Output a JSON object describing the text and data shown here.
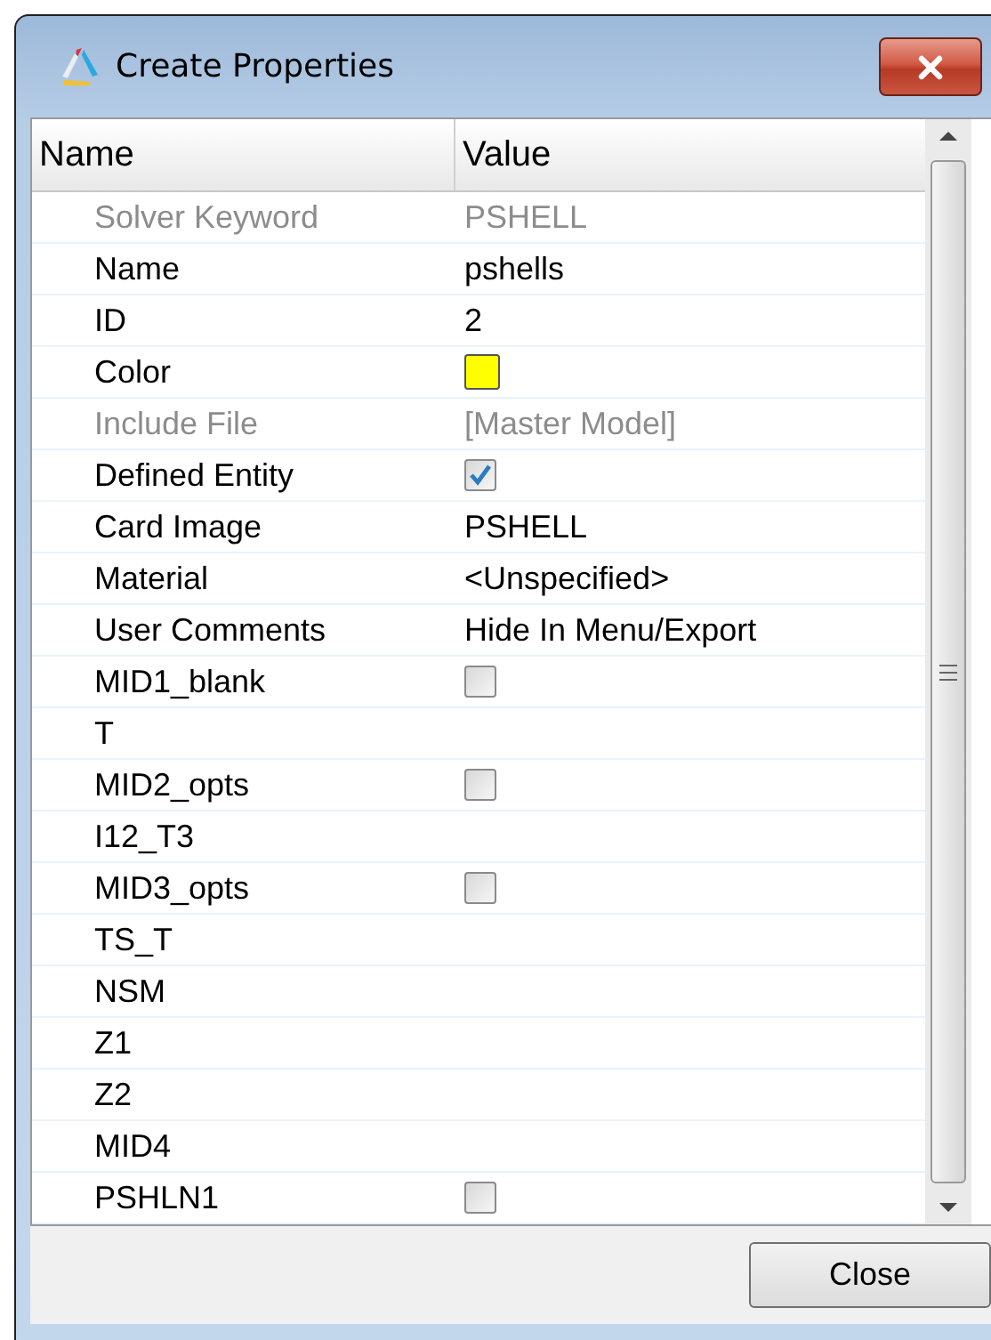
{
  "window": {
    "title": "Create Properties"
  },
  "table": {
    "columns": [
      "Name",
      "Value"
    ],
    "rows": [
      {
        "name": "Solver Keyword",
        "kind": "text",
        "value": "PSHELL",
        "disabled": true
      },
      {
        "name": "Name",
        "kind": "text",
        "value": "pshells",
        "disabled": false
      },
      {
        "name": "ID",
        "kind": "text",
        "value": "2",
        "disabled": false
      },
      {
        "name": "Color",
        "kind": "color",
        "color": "#ffff00",
        "disabled": false
      },
      {
        "name": "Include File",
        "kind": "text",
        "value": "[Master Model]",
        "disabled": true
      },
      {
        "name": "Defined Entity",
        "kind": "checkbox",
        "checked": true,
        "disabled": false
      },
      {
        "name": "Card Image",
        "kind": "text",
        "value": "PSHELL",
        "disabled": false
      },
      {
        "name": "Material",
        "kind": "text",
        "value": "<Unspecified>",
        "disabled": false
      },
      {
        "name": "User Comments",
        "kind": "text",
        "value": "Hide In Menu/Export",
        "disabled": false
      },
      {
        "name": "MID1_blank",
        "kind": "checkbox",
        "checked": false,
        "disabled": false
      },
      {
        "name": "T",
        "kind": "empty",
        "disabled": false
      },
      {
        "name": "MID2_opts",
        "kind": "checkbox",
        "checked": false,
        "disabled": false
      },
      {
        "name": "I12_T3",
        "kind": "empty",
        "disabled": false
      },
      {
        "name": "MID3_opts",
        "kind": "checkbox",
        "checked": false,
        "disabled": false
      },
      {
        "name": "TS_T",
        "kind": "empty",
        "disabled": false
      },
      {
        "name": "NSM",
        "kind": "empty",
        "disabled": false
      },
      {
        "name": "Z1",
        "kind": "empty",
        "disabled": false
      },
      {
        "name": "Z2",
        "kind": "empty",
        "disabled": false
      },
      {
        "name": "MID4",
        "kind": "empty",
        "disabled": false
      },
      {
        "name": "PSHLN1",
        "kind": "checkbox",
        "checked": false,
        "disabled": false
      }
    ]
  },
  "buttons": [
    "Close"
  ]
}
